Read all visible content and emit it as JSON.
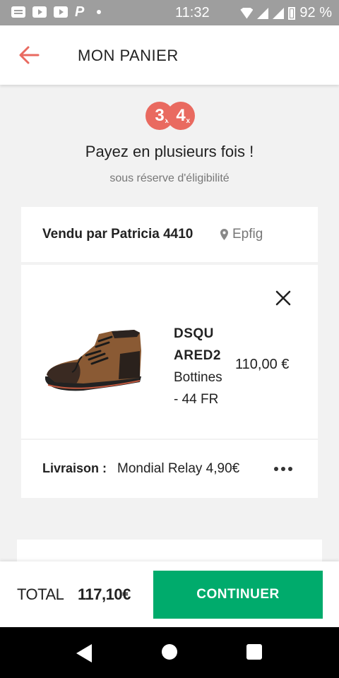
{
  "status_bar": {
    "time": "11:32",
    "battery": "92 %",
    "p_icon": "P"
  },
  "header": {
    "title": "MON PANIER",
    "back_icon": "arrow-left-icon"
  },
  "promo": {
    "badge_1": "3",
    "badge_2": "4",
    "badge_mark": "x",
    "title": "Payez en plusieurs fois !",
    "subtitle": "sous réserve d'éligibilité"
  },
  "seller": {
    "name": "Vendu par Patricia 4410",
    "location": "Epfig"
  },
  "product": {
    "brand_line1": "DSQU",
    "brand_line2": "ARED2",
    "description_line1": "Bottines",
    "description_line2": "- 44 FR",
    "price": "110,00 €"
  },
  "delivery": {
    "label": "Livraison :",
    "value": "Mondial Relay 4,90€"
  },
  "footer": {
    "total_label": "TOTAL",
    "total_value": "117,10€",
    "continue_label": "CONTINUER"
  },
  "colors": {
    "accent": "#e96a60",
    "button": "#00ab6c"
  }
}
